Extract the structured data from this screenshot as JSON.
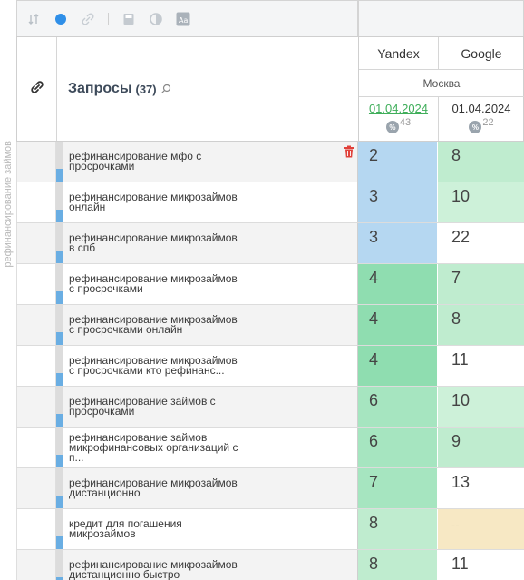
{
  "sidebar": {
    "group_label": "рефинансирование займов"
  },
  "toolbar": {
    "icons": [
      "sort-icon",
      "status-dot-icon",
      "link-icon",
      "calculator-icon",
      "contrast-icon",
      "text-size-icon"
    ]
  },
  "header": {
    "queries_title": "Запросы",
    "queries_count": "(37)",
    "engines": {
      "yandex": "Yandex",
      "google": "Google"
    },
    "region": "Москва",
    "yandex_date": "01.04.2024",
    "yandex_percent": "43",
    "google_date": "01.04.2024",
    "google_percent": "22",
    "percent_badge": "%"
  },
  "colors": {
    "top3": "#b5d7f1",
    "top5": "#8fddb0",
    "top10": "#bfeccf",
    "not_found": "#f7e8c4",
    "default": "#ffffff"
  },
  "rows": [
    {
      "query_line1": "рефинансирование мфо с",
      "query_line2": "просрочками",
      "yandex": "2",
      "google": "8",
      "y_color": "#b5d7f1",
      "g_color": "#bfeccf"
    },
    {
      "query_line1": "рефинансирование микрозаймов",
      "query_line2": "онлайн",
      "yandex": "3",
      "google": "10",
      "y_color": "#b5d7f1",
      "g_color": "#cdf1d9"
    },
    {
      "query_line1": "рефинансирование микрозаймов",
      "query_line2": "в спб",
      "yandex": "3",
      "google": "22",
      "y_color": "#b5d7f1",
      "g_color": "#ffffff"
    },
    {
      "query_line1": "рефинансирование микрозаймов",
      "query_line2": "с просрочками",
      "yandex": "4",
      "google": "7",
      "y_color": "#8fddb0",
      "g_color": "#bfeccf"
    },
    {
      "query_line1": "рефинансирование микрозаймов",
      "query_line2": "с просрочками онлайн",
      "yandex": "4",
      "google": "8",
      "y_color": "#8fddb0",
      "g_color": "#bfeccf"
    },
    {
      "query_line1": "рефинансирование микрозаймов",
      "query_line2": "с просрочками кто рефинанс...",
      "yandex": "4",
      "google": "11",
      "y_color": "#8fddb0",
      "g_color": "#ffffff"
    },
    {
      "query_line1": "рефинансирование займов с",
      "query_line2": "просрочками",
      "yandex": "6",
      "google": "10",
      "y_color": "#a6e5c0",
      "g_color": "#cdf1d9"
    },
    {
      "query_line1": "рефинансирование займов",
      "query_line2": "микрофинансовых организаций с",
      "query_line3": "п...",
      "yandex": "6",
      "google": "9",
      "y_color": "#a6e5c0",
      "g_color": "#bfeccf"
    },
    {
      "query_line1": "рефинансирование микрозаймов",
      "query_line2": "дистанционно",
      "yandex": "7",
      "google": "13",
      "y_color": "#a6e5c0",
      "g_color": "#ffffff"
    },
    {
      "query_line1": "кредит для погашения",
      "query_line2": "микрозаймов",
      "yandex": "8",
      "google": "--",
      "y_color": "#bfeccf",
      "g_color": "#f7e8c4"
    },
    {
      "query_line1": "рефинансирование микрозаймов",
      "query_line2": "дистанционно быстро",
      "yandex": "8",
      "google": "11",
      "y_color": "#bfeccf",
      "g_color": "#ffffff"
    }
  ]
}
